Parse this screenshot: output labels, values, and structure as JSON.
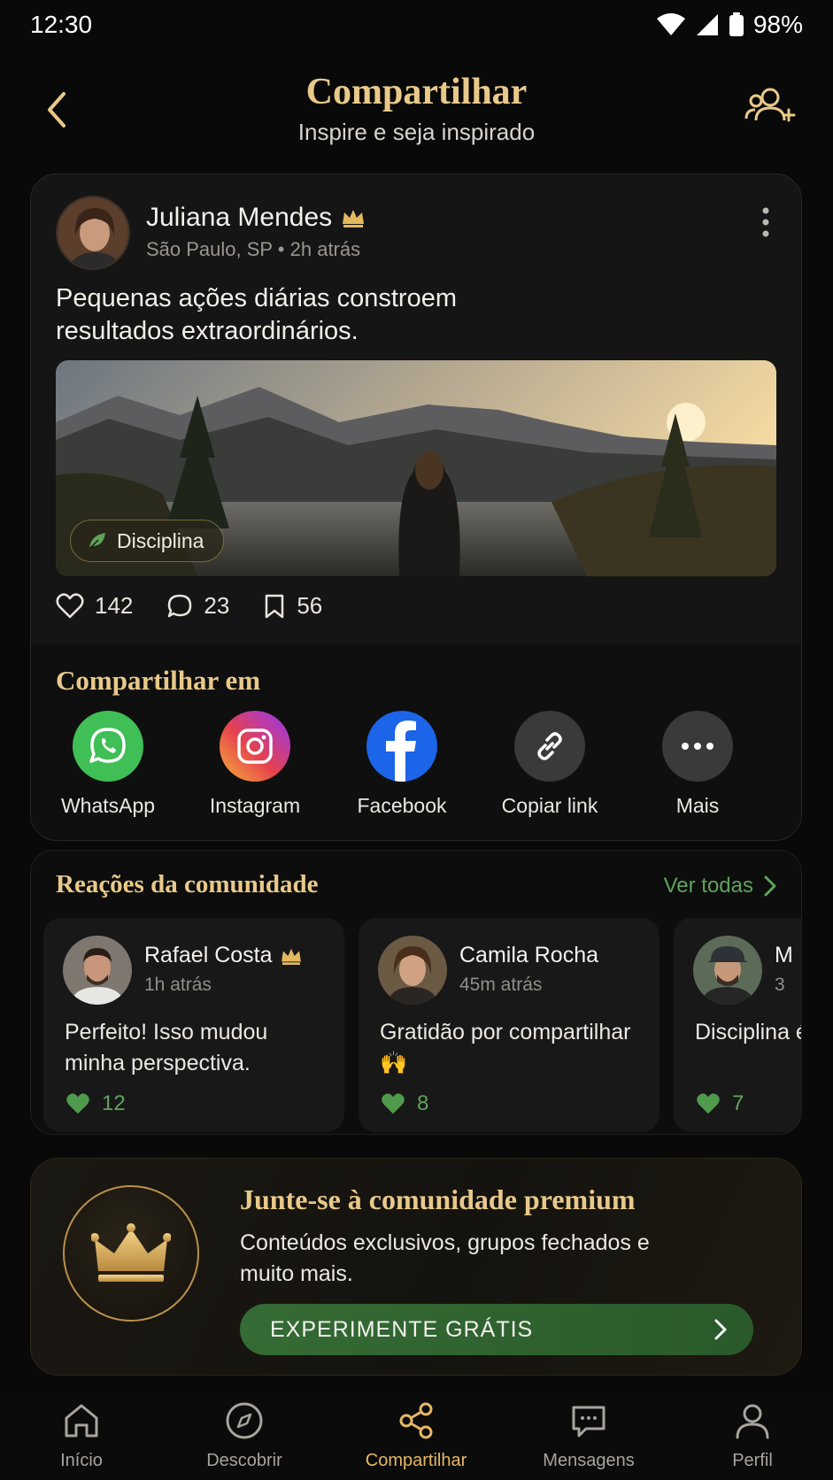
{
  "status_bar": {
    "time": "12:30",
    "battery": "98%"
  },
  "header": {
    "title": "Compartilhar",
    "subtitle": "Inspire e seja inspirado"
  },
  "post": {
    "author": "Juliana Mendes",
    "meta": "São Paulo, SP • 2h atrás",
    "text": "Pequenas ações diárias constroem resultados extraordinários.",
    "tag": "Disciplina",
    "likes": "142",
    "comments": "23",
    "saves": "56"
  },
  "share": {
    "title": "Compartilhar em",
    "items": [
      {
        "label": "WhatsApp",
        "icon": "whatsapp-icon",
        "color": "#3fbf56"
      },
      {
        "label": "Instagram",
        "icon": "instagram-icon",
        "color": "#d6366f"
      },
      {
        "label": "Facebook",
        "icon": "facebook-icon",
        "color": "#1c64e8"
      },
      {
        "label": "Copiar link",
        "icon": "link-icon",
        "color": "#3a3a3a"
      },
      {
        "label": "Mais",
        "icon": "more-icon",
        "color": "#3a3a3a"
      }
    ]
  },
  "reactions": {
    "title": "Reações da comunidade",
    "see_all": "Ver todas",
    "items": [
      {
        "name": "Rafael Costa",
        "time": "1h atrás",
        "text": "Perfeito! Isso mudou minha perspectiva.",
        "likes": "12"
      },
      {
        "name": "Camila Rocha",
        "time": "45m atrás",
        "text": "Gratidão por compartilhar 🙌",
        "likes": "8"
      },
      {
        "name": "M",
        "time": "3",
        "text": "Disciplina é a chave! p",
        "likes": "7"
      }
    ]
  },
  "premium": {
    "title": "Junte-se à comunidade premium",
    "text": "Conteúdos exclusivos, grupos fechados e muito mais.",
    "cta": "EXPERIMENTE GRÁTIS"
  },
  "nav": {
    "items": [
      {
        "label": "Início",
        "icon": "home-icon",
        "active": false
      },
      {
        "label": "Descobrir",
        "icon": "compass-icon",
        "active": false
      },
      {
        "label": "Compartilhar",
        "icon": "share-icon",
        "active": true
      },
      {
        "label": "Mensagens",
        "icon": "message-icon",
        "active": false
      },
      {
        "label": "Perfil",
        "icon": "profile-icon",
        "active": false
      }
    ]
  },
  "colors": {
    "gold": "#e9c98a",
    "green": "#5fa35b",
    "background": "#090909",
    "active_nav": "#e6b865"
  }
}
